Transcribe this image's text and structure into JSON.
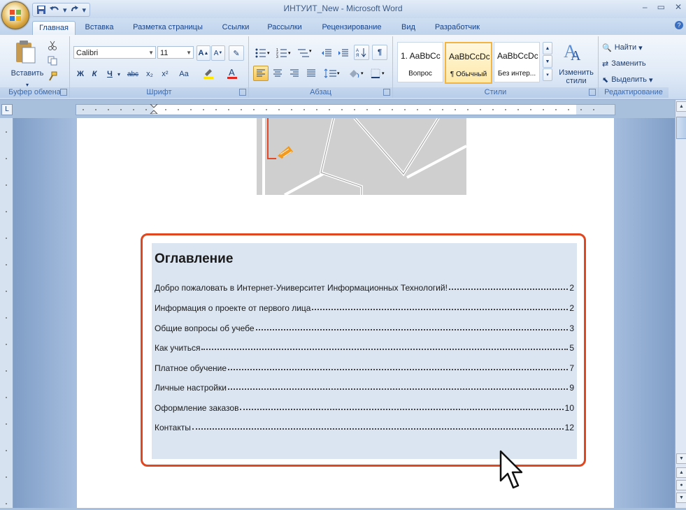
{
  "window": {
    "title": "ИНТУИТ_New - Microsoft Word",
    "controls": [
      "–",
      "▭",
      "✕"
    ]
  },
  "qat": {
    "save_icon": "save-icon",
    "undo_icon": "undo-icon",
    "redo_icon": "redo-icon",
    "more": "▾"
  },
  "tabs": [
    {
      "label": "Главная",
      "active": true
    },
    {
      "label": "Вставка"
    },
    {
      "label": "Разметка страницы"
    },
    {
      "label": "Ссылки"
    },
    {
      "label": "Рассылки"
    },
    {
      "label": "Рецензирование"
    },
    {
      "label": "Вид"
    },
    {
      "label": "Разработчик"
    }
  ],
  "ribbon": {
    "clipboard": {
      "label": "Буфер обмена",
      "paste": "Вставить"
    },
    "font": {
      "label": "Шрифт",
      "name": "Calibri",
      "size": "11",
      "buttons": [
        "Ж",
        "К",
        "Ч",
        "abc",
        "x₂",
        "x²",
        "Aa"
      ]
    },
    "paragraph": {
      "label": "Абзац"
    },
    "styles": {
      "label": "Стили",
      "items": [
        {
          "sample": "1. AaBbCc",
          "name": "Вопрос"
        },
        {
          "sample": "AaBbCcDc",
          "name": "¶ Обычный",
          "selected": true
        },
        {
          "sample": "AaBbCcDc",
          "name": "Без интер..."
        }
      ],
      "change": "Изменить стили"
    },
    "editing": {
      "label": "Редактирование",
      "find": "Найти",
      "replace": "Заменить",
      "select": "Выделить"
    }
  },
  "toc": {
    "heading": "Оглавление",
    "entries": [
      {
        "text": "Добро пожаловать в Интернет-Университет Информационных Технологий!",
        "page": "2"
      },
      {
        "text": "Информация о проекте от первого лица",
        "page": "2"
      },
      {
        "text": "Общие вопросы об учебе",
        "page": "3"
      },
      {
        "text": "Как учиться",
        "page": "5"
      },
      {
        "text": "Платное обучение",
        "page": "7"
      },
      {
        "text": "Личные настройки",
        "page": "9"
      },
      {
        "text": "Оформление заказов",
        "page": "10"
      },
      {
        "text": "Контакты",
        "page": "12"
      }
    ]
  },
  "colors": {
    "highlight_frame": "#e0461f",
    "toc_background": "#dbe5f1",
    "accent": "#15428b"
  }
}
